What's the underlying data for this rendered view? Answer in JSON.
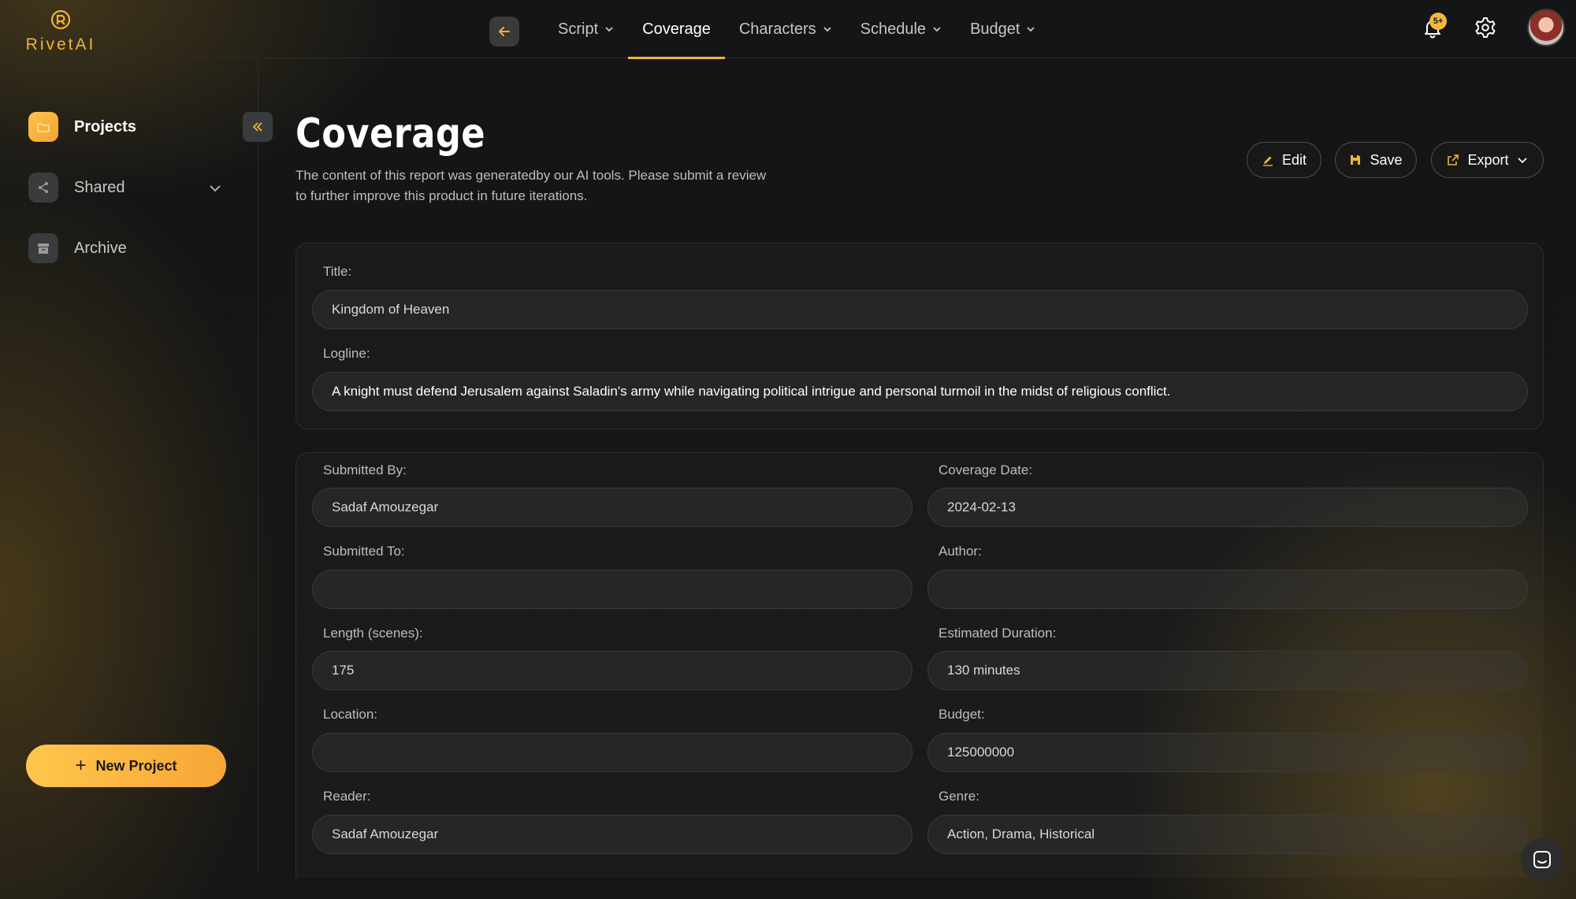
{
  "app": {
    "brand": "RivetAI"
  },
  "nav": {
    "items": [
      {
        "label": "Script",
        "has_dropdown": true
      },
      {
        "label": "Coverage",
        "has_dropdown": false,
        "active": true
      },
      {
        "label": "Characters",
        "has_dropdown": true
      },
      {
        "label": "Schedule",
        "has_dropdown": true
      },
      {
        "label": "Budget",
        "has_dropdown": true
      }
    ],
    "notifications_badge": "5+"
  },
  "sidebar": {
    "items": [
      {
        "label": "Projects",
        "icon": "folder-icon",
        "active": true
      },
      {
        "label": "Shared",
        "icon": "share-icon"
      },
      {
        "label": "Archive",
        "icon": "archive-icon"
      }
    ],
    "new_project_label": "New Project"
  },
  "page": {
    "title": "Coverage",
    "description": "The content of this report was generatedby our AI tools. Please submit a review to further improve this product in future iterations.",
    "actions": {
      "edit": "Edit",
      "save": "Save",
      "export": "Export"
    }
  },
  "overview": {
    "title_label": "Title:",
    "title_value": "Kingdom of Heaven",
    "logline_label": "Logline:",
    "logline_value": "A knight must defend Jerusalem against Saladin's army while navigating political intrigue and personal turmoil in the midst of religious conflict."
  },
  "details": {
    "submitted_by": {
      "label": "Submitted By:",
      "value": "Sadaf Amouzegar"
    },
    "coverage_date": {
      "label": "Coverage Date:",
      "value": "2024-02-13"
    },
    "submitted_to": {
      "label": "Submitted To:",
      "value": ""
    },
    "author": {
      "label": "Author:",
      "value": ""
    },
    "length": {
      "label": "Length (scenes):",
      "value": "175"
    },
    "duration": {
      "label": "Estimated Duration:",
      "value": "130 minutes"
    },
    "location": {
      "label": "Location:",
      "value": ""
    },
    "budget": {
      "label": "Budget:",
      "value": "125000000"
    },
    "reader": {
      "label": "Reader:",
      "value": "Sadaf Amouzegar"
    },
    "genre": {
      "label": "Genre:",
      "value": "Action, Drama, Historical"
    }
  },
  "colors": {
    "accent": "#f0b436",
    "background": "#141414"
  }
}
